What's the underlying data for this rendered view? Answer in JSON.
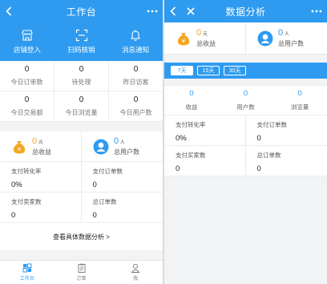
{
  "colors": {
    "primary": "#2e9bf0",
    "gold": "#f5a623"
  },
  "left": {
    "title": "工作台",
    "quick_actions": [
      {
        "label": "店铺登入",
        "icon": "shop-icon"
      },
      {
        "label": "扫码核销",
        "icon": "scan-icon"
      },
      {
        "label": "消息通知",
        "icon": "bell-icon"
      }
    ],
    "grid": [
      [
        {
          "value": "0",
          "label": "今日订单数"
        },
        {
          "value": "0",
          "label": "待处理"
        },
        {
          "value": "0",
          "label": "昨日访客"
        }
      ],
      [
        {
          "value": "0",
          "label": "今日交易额"
        },
        {
          "value": "0",
          "label": "今日浏览量"
        },
        {
          "value": "0",
          "label": "今日用户数"
        }
      ]
    ],
    "summary": {
      "revenue": {
        "value": "0",
        "unit": "元",
        "label": "总收益"
      },
      "users": {
        "value": "0",
        "unit": "人",
        "label": "总用户数"
      }
    },
    "stats": [
      {
        "label": "支付转化率",
        "value": "0%"
      },
      {
        "label": "支付订单数",
        "value": "0"
      },
      {
        "label": "支付卖家数",
        "value": "0"
      },
      {
        "label": "总订单数",
        "value": "0"
      }
    ],
    "more_link": "查看具体数据分析 >",
    "tabs": [
      {
        "label": "工作台",
        "icon": "dashboard-icon"
      },
      {
        "label": "订单",
        "icon": "order-icon"
      },
      {
        "label": "我",
        "icon": "user-icon"
      }
    ]
  },
  "right": {
    "title": "数据分析",
    "summary": {
      "revenue": {
        "value": "0",
        "unit": "元",
        "label": "总收益"
      },
      "users": {
        "value": "0",
        "unit": "人",
        "label": "总用户数"
      }
    },
    "ranges": [
      "7天",
      "15天",
      "30天"
    ],
    "metrics": [
      {
        "value": "0",
        "label": "收益"
      },
      {
        "value": "0",
        "label": "用户数"
      },
      {
        "value": "0",
        "label": "浏览量"
      }
    ],
    "stats": [
      {
        "label": "支付转化率",
        "value": "0%"
      },
      {
        "label": "支付订单数",
        "value": "0"
      },
      {
        "label": "支付买家数",
        "value": "0"
      },
      {
        "label": "总订单数",
        "value": "0"
      }
    ]
  }
}
